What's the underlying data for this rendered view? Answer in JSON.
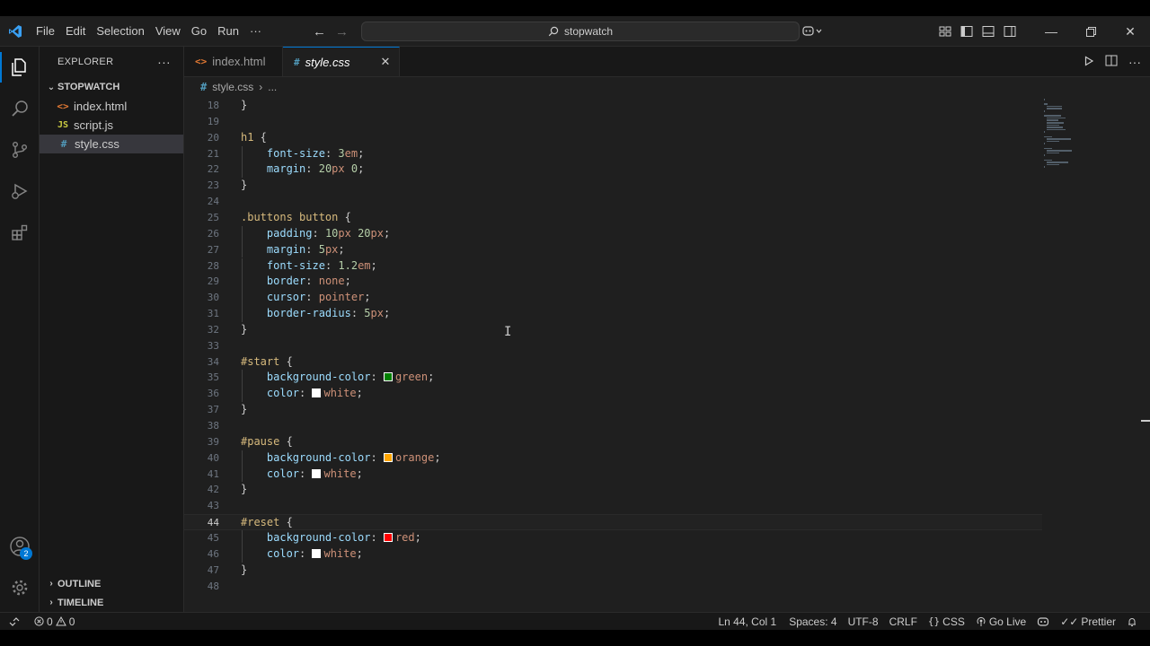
{
  "app": {
    "title": "stopwatch"
  },
  "menu": [
    "File",
    "Edit",
    "Selection",
    "View",
    "Go",
    "Run",
    "···"
  ],
  "sidebar": {
    "header": "EXPLORER",
    "more": "···",
    "folder": "STOPWATCH",
    "files": [
      {
        "name": "index.html",
        "icon": "<>",
        "kind": "html"
      },
      {
        "name": "script.js",
        "icon": "JS",
        "kind": "js"
      },
      {
        "name": "style.css",
        "icon": "#",
        "kind": "css",
        "selected": true
      }
    ],
    "outline": "OUTLINE",
    "timeline": "TIMELINE"
  },
  "accounts_badge": "2",
  "tabs": [
    {
      "label": "index.html",
      "icon": "<>",
      "active": false
    },
    {
      "label": "style.css",
      "icon": "#",
      "active": true,
      "close": "✕"
    }
  ],
  "breadcrumb": {
    "file": "style.css",
    "sep": "›",
    "rest": "..."
  },
  "code_lines": [
    {
      "n": "18",
      "html": "}"
    },
    {
      "n": "19",
      "html": ""
    },
    {
      "n": "20",
      "html": "<span class='sel'>h1</span> {"
    },
    {
      "n": "21",
      "html": "    <span class='prop'>font-size</span>: <span class='num'>3</span><span class='val'>em</span>;"
    },
    {
      "n": "22",
      "html": "    <span class='prop'>margin</span>: <span class='num'>20</span><span class='val'>px</span> <span class='num'>0</span>;"
    },
    {
      "n": "23",
      "html": "}"
    },
    {
      "n": "24",
      "html": ""
    },
    {
      "n": "25",
      "html": "<span class='sel'>.buttons button</span> {"
    },
    {
      "n": "26",
      "html": "    <span class='prop'>padding</span>: <span class='num'>10</span><span class='val'>px</span> <span class='num'>20</span><span class='val'>px</span>;"
    },
    {
      "n": "27",
      "html": "    <span class='prop'>margin</span>: <span class='num'>5</span><span class='val'>px</span>;"
    },
    {
      "n": "28",
      "html": "    <span class='prop'>font-size</span>: <span class='num'>1.2</span><span class='val'>em</span>;"
    },
    {
      "n": "29",
      "html": "    <span class='prop'>border</span>: <span class='val'>none</span>;"
    },
    {
      "n": "30",
      "html": "    <span class='prop'>cursor</span>: <span class='val'>pointer</span>;"
    },
    {
      "n": "31",
      "html": "    <span class='prop'>border-radius</span>: <span class='num'>5</span><span class='val'>px</span>;"
    },
    {
      "n": "32",
      "html": "}"
    },
    {
      "n": "33",
      "html": ""
    },
    {
      "n": "34",
      "html": "<span class='sel'>#start</span> {"
    },
    {
      "n": "35",
      "html": "    <span class='prop'>background-color</span>: <span class='swatch' style='background:#008000'></span><span class='val'>green</span>;"
    },
    {
      "n": "36",
      "html": "    <span class='prop'>color</span>: <span class='swatch' style='background:#ffffff'></span><span class='val'>white</span>;"
    },
    {
      "n": "37",
      "html": "}"
    },
    {
      "n": "38",
      "html": ""
    },
    {
      "n": "39",
      "html": "<span class='sel'>#pause</span> {"
    },
    {
      "n": "40",
      "html": "    <span class='prop'>background-color</span>: <span class='swatch' style='background:#ffa500'></span><span class='val'>orange</span>;"
    },
    {
      "n": "41",
      "html": "    <span class='prop'>color</span>: <span class='swatch' style='background:#ffffff'></span><span class='val'>white</span>;"
    },
    {
      "n": "42",
      "html": "}"
    },
    {
      "n": "43",
      "html": ""
    },
    {
      "n": "44",
      "html": "<span class='sel'>#reset</span> {",
      "current": true
    },
    {
      "n": "45",
      "html": "    <span class='prop'>background-color</span>: <span class='swatch' style='background:#ff0000'></span><span class='val'>red</span>;"
    },
    {
      "n": "46",
      "html": "    <span class='prop'>color</span>: <span class='swatch' style='background:#ffffff'></span><span class='val'>white</span>;"
    },
    {
      "n": "47",
      "html": "}"
    },
    {
      "n": "48",
      "html": ""
    }
  ],
  "status": {
    "errors": "0",
    "warnings": "0",
    "position": "Ln 44, Col 1",
    "spaces": "Spaces: 4",
    "encoding": "UTF-8",
    "eol": "CRLF",
    "language": "CSS",
    "golive": "Go Live",
    "prettier": "Prettier"
  },
  "colors": {
    "accent": "#0078d4",
    "background": "#1f1f1f",
    "sidebar": "#181818"
  }
}
